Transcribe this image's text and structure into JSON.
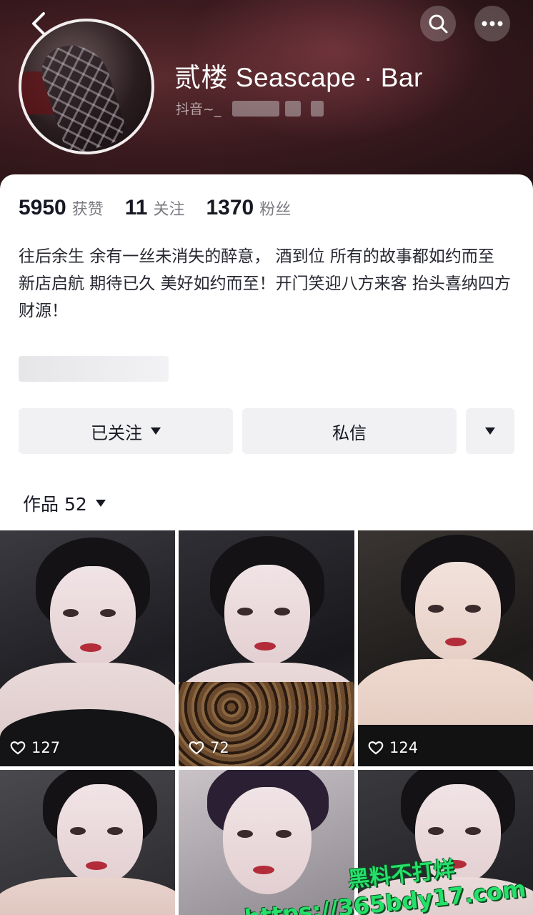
{
  "header": {
    "name": "贰楼 Seascape · Bar",
    "subline": "抖音~_"
  },
  "stats": [
    {
      "value": "5950",
      "label": "获赞"
    },
    {
      "value": "11",
      "label": "关注"
    },
    {
      "value": "1370",
      "label": "粉丝"
    }
  ],
  "bio": {
    "line1": "往后余生  余有一丝未消失的醉意，  酒到位  所有的故事都如约而至",
    "line2": "新店启航  期待已久 美好如约而至！开门笑迎八方来客   抬头喜纳四方财源！"
  },
  "actions": {
    "follow_label": "已关注",
    "message_label": "私信"
  },
  "works": {
    "label": "作品 52"
  },
  "posts": [
    {
      "likes": "127"
    },
    {
      "likes": "72"
    },
    {
      "likes": "124"
    },
    {
      "likes": ""
    },
    {
      "likes": ""
    },
    {
      "likes": ""
    }
  ],
  "watermark": {
    "line1": "黑料不打烊",
    "line2": "https://365bdy17.com"
  },
  "colors": {
    "banner": "#3a1a1e",
    "button_bg": "#f1f1f3",
    "watermark": "#25e06a"
  }
}
